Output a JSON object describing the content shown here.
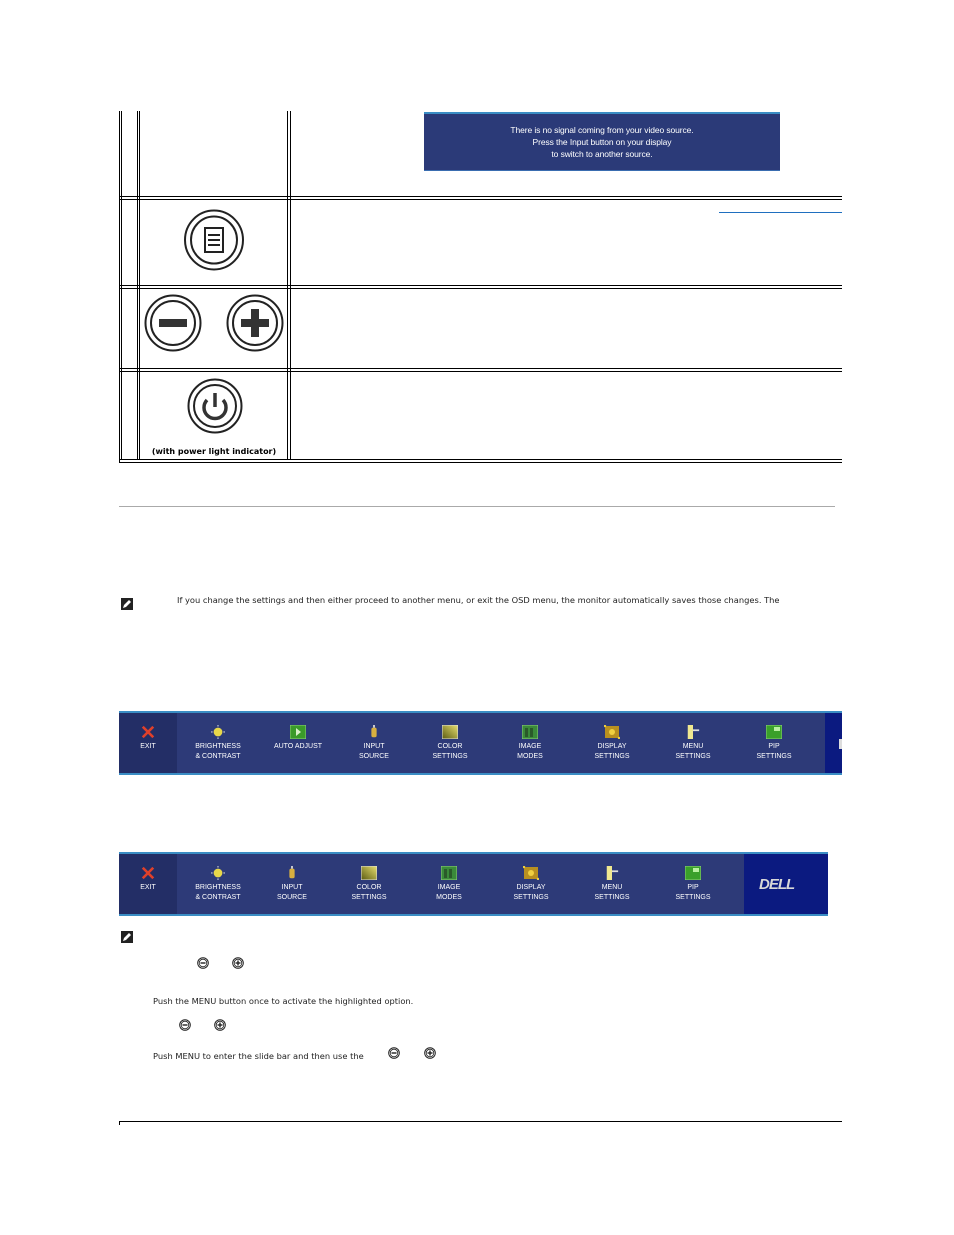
{
  "no_signal_dialog": {
    "lines": [
      "There is no signal coming from your video source.",
      "Press the Input button on your display",
      "to switch to another source."
    ]
  },
  "controls_table": {
    "rows": [
      {
        "icon": "menu-button-icon"
      },
      {
        "icon": "minus-plus-buttons-icon"
      },
      {
        "icon": "power-button-icon",
        "caption": "(with power light indicator)"
      }
    ]
  },
  "note": {
    "icon": "note-pencil-icon",
    "text": "If you change the settings and then either proceed to another menu, or exit the OSD menu, the monitor automatically saves those changes. The"
  },
  "osd_menu_1": {
    "items": [
      {
        "icon": "exit-icon",
        "line1": "EXIT",
        "line2": ""
      },
      {
        "icon": "brightness-icon",
        "line1": "BRIGHTNESS",
        "line2": "& CONTRAST"
      },
      {
        "icon": "auto-adjust-icon",
        "line1": "AUTO ADJUST",
        "line2": ""
      },
      {
        "icon": "input-source-icon",
        "line1": "INPUT",
        "line2": "SOURCE"
      },
      {
        "icon": "color-settings-icon",
        "line1": "COLOR",
        "line2": "SETTINGS"
      },
      {
        "icon": "image-modes-icon",
        "line1": "IMAGE",
        "line2": "MODES"
      },
      {
        "icon": "display-settings-icon",
        "line1": "DISPLAY",
        "line2": "SETTINGS"
      },
      {
        "icon": "menu-settings-icon",
        "line1": "MENU",
        "line2": "SETTINGS"
      },
      {
        "icon": "pip-settings-icon",
        "line1": "PIP",
        "line2": "SETTINGS"
      }
    ]
  },
  "osd_menu_2": {
    "items": [
      {
        "icon": "exit-icon",
        "line1": "EXIT",
        "line2": ""
      },
      {
        "icon": "brightness-icon",
        "line1": "BRIGHTNESS",
        "line2": "& CONTRAST"
      },
      {
        "icon": "input-source-icon",
        "line1": "INPUT",
        "line2": "SOURCE"
      },
      {
        "icon": "color-settings-icon",
        "line1": "COLOR",
        "line2": "SETTINGS"
      },
      {
        "icon": "image-modes-icon",
        "line1": "IMAGE",
        "line2": "MODES"
      },
      {
        "icon": "display-settings-icon",
        "line1": "DISPLAY",
        "line2": "SETTINGS"
      },
      {
        "icon": "menu-settings-icon",
        "line1": "MENU",
        "line2": "SETTINGS"
      },
      {
        "icon": "pip-settings-icon",
        "line1": "PIP",
        "line2": "SETTINGS"
      }
    ],
    "logo": "DELL"
  },
  "steps": {
    "step_activate": "Push the MENU button once to activate the highlighted option.",
    "step_slide": "Push MENU to enter the slide bar and then use the"
  },
  "colors": {
    "osd_bg": "#2d3a78",
    "osd_exit_bg": "#232e66",
    "osd_accent": "#3a8dc4",
    "dell_panel": "#0b1a80",
    "link": "#1f6fbf"
  }
}
